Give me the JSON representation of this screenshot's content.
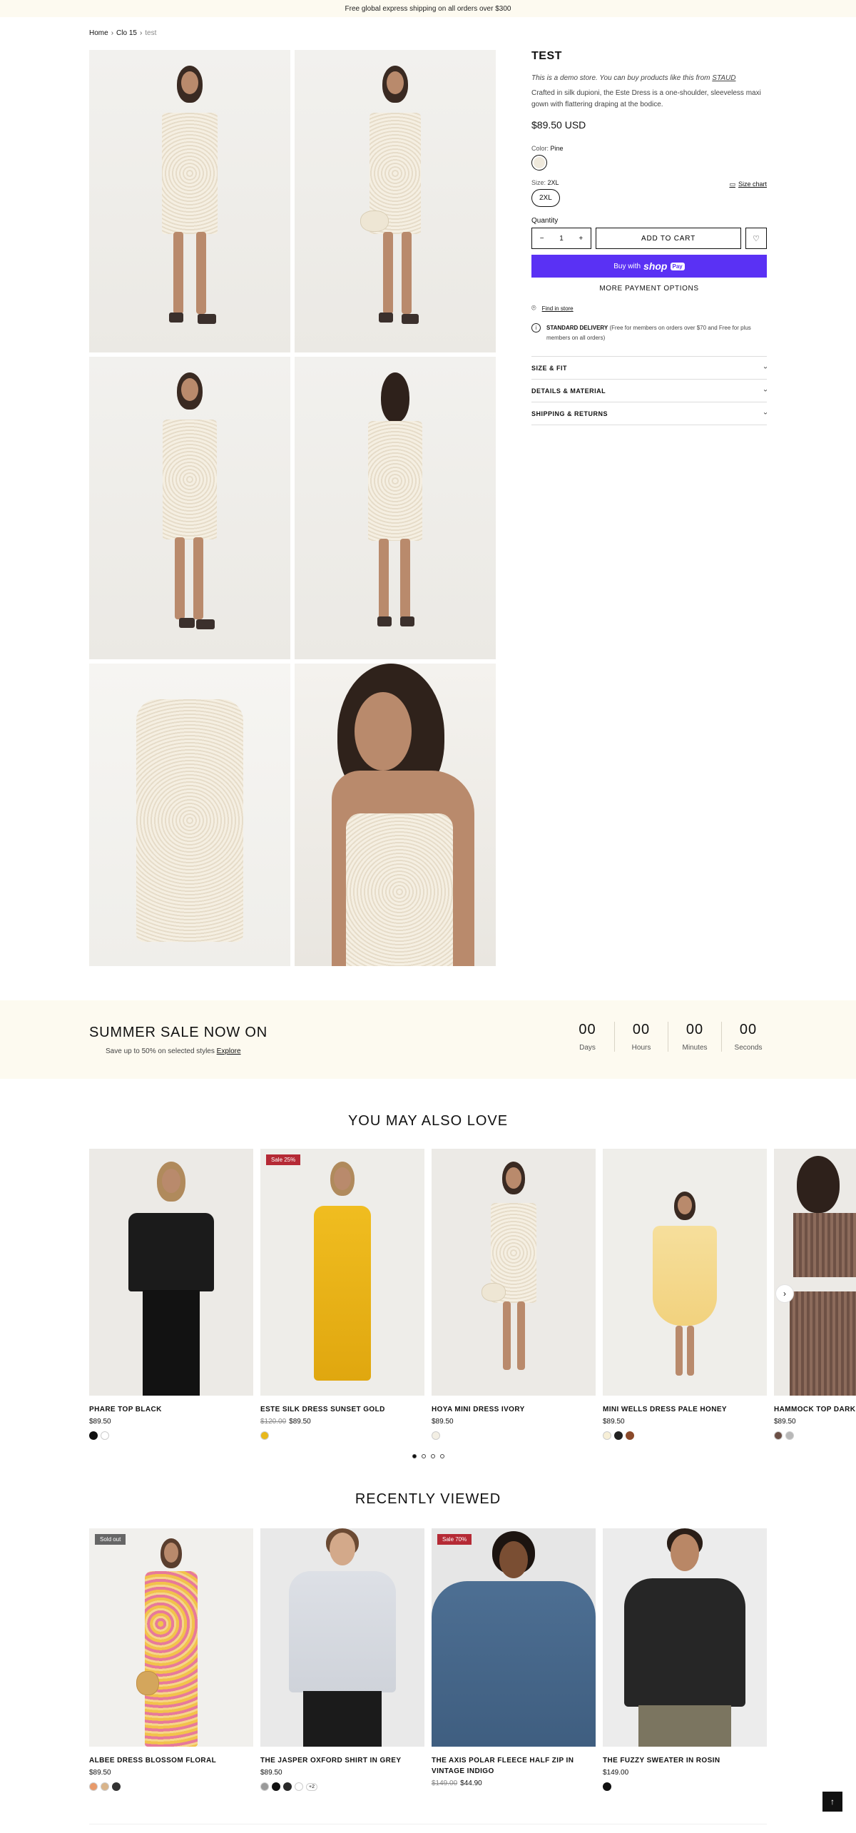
{
  "announcement": "Free global express shipping on all orders over $300",
  "breadcrumb": {
    "home": "Home",
    "collection": "Clo 15",
    "current": "test"
  },
  "product": {
    "title": "TEST",
    "demo_note_prefix": "This is a demo store. You can buy products like this from",
    "demo_note_link": "STAUD",
    "description": "Crafted in silk dupioni, the Este Dress is a one-shoulder, sleeveless maxi gown with flattering draping at the bodice.",
    "price": "$89.50 USD",
    "color_label": "Color:",
    "color_value": "Pine",
    "size_label": "Size:",
    "size_value": "2XL",
    "size_chart": "Size chart",
    "size_option": "2XL",
    "quantity_label": "Quantity",
    "quantity_value": "1",
    "add_to_cart": "ADD TO CART",
    "buy_with": "Buy with",
    "shop_brand": "shop",
    "shop_pay": "Pay",
    "more_payment": "MORE PAYMENT OPTIONS",
    "find_in_store": "Find in store",
    "delivery_title": "STANDARD DELIVERY",
    "delivery_text": "(Free for members on orders over $70 and Free for plus members on all orders)",
    "accordion": [
      "SIZE & FIT",
      "DETAILS & MATERIAL",
      "SHIPPING & RETURNS"
    ]
  },
  "sale": {
    "title": "SUMMER SALE NOW ON",
    "subtitle": "Save up to 50% on selected styles",
    "link": "Explore",
    "countdown": [
      {
        "value": "00",
        "label": "Days"
      },
      {
        "value": "00",
        "label": "Hours"
      },
      {
        "value": "00",
        "label": "Minutes"
      },
      {
        "value": "00",
        "label": "Seconds"
      }
    ]
  },
  "also_love": {
    "title": "YOU MAY ALSO LOVE",
    "items": [
      {
        "name": "PHARE TOP BLACK",
        "price": "$89.50",
        "old_price": "",
        "badge": "",
        "swatches": [
          "#111111",
          "#ffffff"
        ]
      },
      {
        "name": "ESTE SILK DRESS SUNSET GOLD",
        "price": "$89.50",
        "old_price": "$120.00",
        "badge": "Sale 25%",
        "swatches": [
          "#e8b81a"
        ]
      },
      {
        "name": "HOYA MINI DRESS IVORY",
        "price": "$89.50",
        "old_price": "",
        "badge": "",
        "swatches": [
          "#f3efe4"
        ]
      },
      {
        "name": "MINI WELLS DRESS PALE HONEY",
        "price": "$89.50",
        "old_price": "",
        "badge": "",
        "swatches": [
          "#f7efd7",
          "#222222",
          "#8b4a2b"
        ]
      },
      {
        "name": "HAMMOCK TOP DARK C",
        "price": "$89.50",
        "old_price": "",
        "badge": "",
        "swatches": [
          "#6b4f45",
          "#b8b8b8"
        ]
      }
    ]
  },
  "recently_viewed": {
    "title": "RECENTLY VIEWED",
    "items": [
      {
        "name": "ALBEE DRESS BLOSSOM FLORAL",
        "price": "$89.50",
        "old_price": "",
        "badge": "Sold out",
        "swatches": [
          "#e89a6a",
          "#d9b48a",
          "#333333"
        ],
        "more": ""
      },
      {
        "name": "THE JASPER OXFORD SHIRT IN GREY",
        "price": "$89.50",
        "old_price": "",
        "badge": "",
        "swatches": [
          "#9a9a9a",
          "#111111",
          "#2a2a2a",
          "#ffffff"
        ],
        "more": "+2"
      },
      {
        "name": "THE AXIS POLAR FLEECE HALF ZIP IN VINTAGE INDIGO",
        "price": "$44.90",
        "old_price": "$149.00",
        "badge": "Sale 70%",
        "swatches": [],
        "more": ""
      },
      {
        "name": "THE FUZZY SWEATER IN ROSIN",
        "price": "$149.00",
        "old_price": "",
        "badge": "",
        "swatches": [
          "#111111"
        ],
        "more": ""
      }
    ]
  },
  "icons": {
    "size_chart": "ruler-icon",
    "wishlist": "heart-icon",
    "store": "location-pin-icon",
    "delivery": "info-icon",
    "carousel_next": "chevron-right-icon",
    "back_to_top": "arrow-up-icon"
  },
  "colors": {
    "shop_pay": "#5a31f4",
    "sale_badge": "#b52a35",
    "band": "#fdfaf0"
  }
}
